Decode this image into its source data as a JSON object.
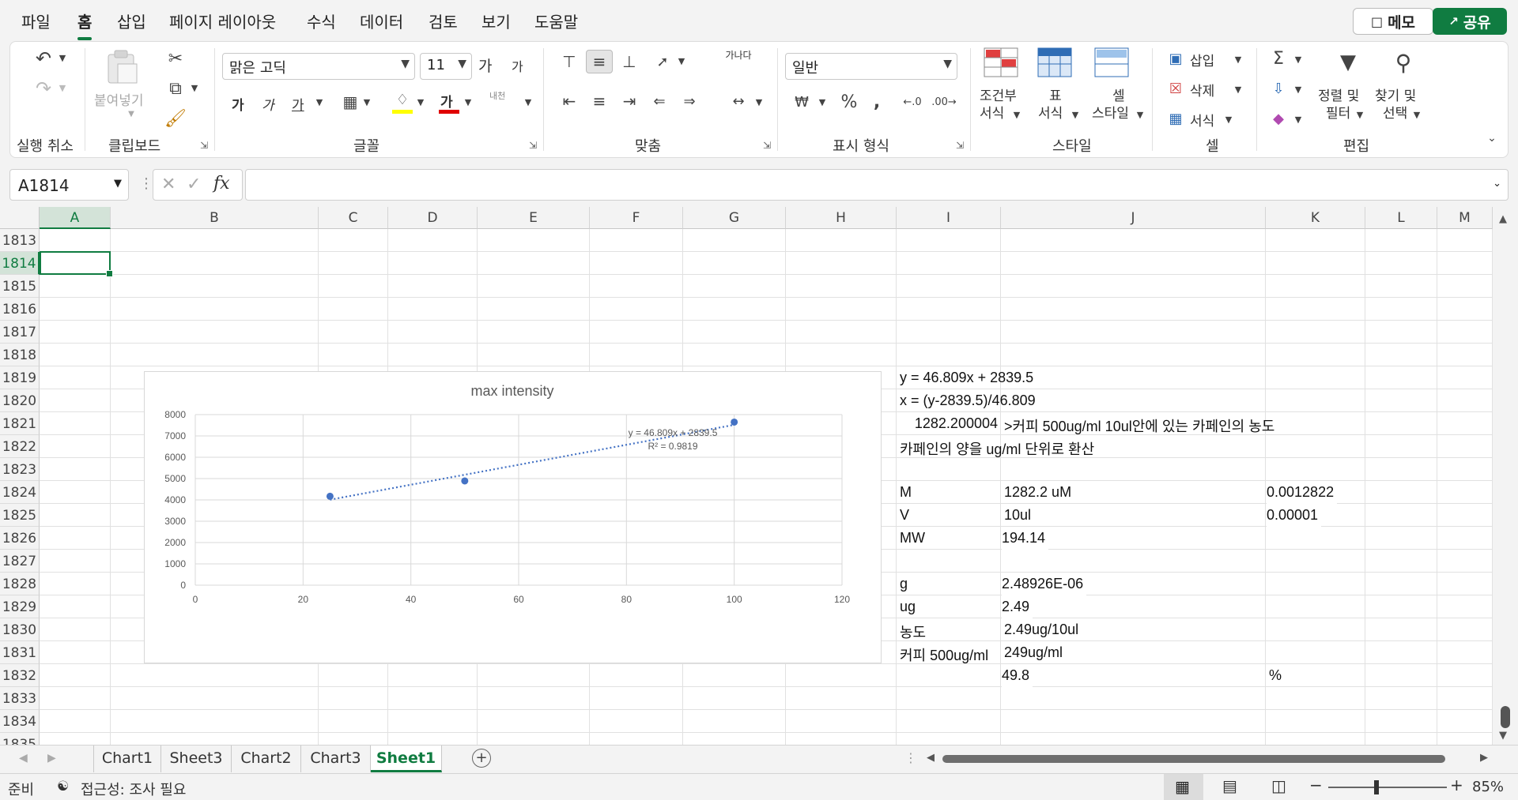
{
  "menu": {
    "tabs": [
      "파일",
      "홈",
      "삽입",
      "페이지 레이아웃",
      "수식",
      "데이터",
      "검토",
      "보기",
      "도움말"
    ],
    "active": "홈",
    "memo_label": "메모",
    "share_label": "공유"
  },
  "ribbon": {
    "undo_group": "실행 취소",
    "clipboard_group": "클립보드",
    "paste_label": "붙여넣기",
    "font_group": "글꼴",
    "font_name": "맑은 고딕",
    "font_size": "11",
    "grow_font": "가",
    "shrink_font": "가",
    "bold": "가",
    "italic": "가",
    "underline": "가",
    "font_color_glyph": "가",
    "phonetic": "내천",
    "align_group": "맞춤",
    "wrap_text": "가나다",
    "number_group": "표시 형식",
    "number_format": "일반",
    "styles_group": "스타일",
    "cond_format": [
      "조건부",
      "서식"
    ],
    "table_format": [
      "표",
      "서식"
    ],
    "cell_styles": [
      "셀",
      "스타일"
    ],
    "cells_group": "셀",
    "insert": "삽입",
    "delete": "삭제",
    "format": "서식",
    "edit_group": "편집",
    "sort_filter": [
      "정렬 및",
      "필터"
    ],
    "find_select": [
      "찾기 및",
      "선택"
    ],
    "colors": {
      "accent": "#107c41",
      "fill_yellow": "#ffff00",
      "font_red": "#e00000"
    }
  },
  "formula_bar": {
    "name_box": "A1814",
    "fx": "fx",
    "content": ""
  },
  "sheet": {
    "columns": [
      "A",
      "B",
      "C",
      "D",
      "E",
      "F",
      "G",
      "H",
      "I",
      "J",
      "K",
      "L",
      "M"
    ],
    "selected_column": "A",
    "rows": [
      "1813",
      "1814",
      "1815",
      "1816",
      "1817",
      "1818",
      "1819",
      "1820",
      "1821",
      "1822",
      "1823",
      "1824",
      "1825",
      "1826",
      "1827",
      "1828",
      "1829",
      "1830",
      "1831",
      "1832",
      "1833",
      "1834",
      "1835"
    ],
    "selected_row": "1814",
    "cells": {
      "I1819": "y = 46.809x + 2839.5",
      "I1820": "x = (y-2839.5)/46.809",
      "I1821": "1282.200004",
      "J1821": ">커피 500ug/ml 10ul안에 있는 카페인의 농도",
      "I1822": "카페인의 양을 ug/ml 단위로 환산",
      "I1824": "M",
      "J1824": "1282.2 uM",
      "K1824": "0.0012822",
      "I1825": "V",
      "J1825": "10ul",
      "K1825": "0.00001",
      "I1826": "MW",
      "J1826": "194.14",
      "I1828": "g",
      "J1828": "2.48926E-06",
      "I1829": "ug",
      "J1829": "2.49",
      "I1830": "농도",
      "J1830": "2.49ug/10ul",
      "I1831": "커피 500ug/ml",
      "J1831": "249ug/ml",
      "J1832": "49.8",
      "K1832": "%"
    }
  },
  "chart_data": {
    "type": "scatter",
    "title": "max intensity",
    "xlabel": "",
    "ylabel": "",
    "xlim": [
      0,
      120
    ],
    "ylim": [
      0,
      8000
    ],
    "xticks": [
      "0",
      "20",
      "40",
      "60",
      "80",
      "100",
      "120"
    ],
    "yticks": [
      "0",
      "1000",
      "2000",
      "3000",
      "4000",
      "5000",
      "6000",
      "7000",
      "8000"
    ],
    "series": [
      {
        "x": [
          25,
          50,
          100
        ],
        "y": [
          4170,
          4890,
          7650
        ]
      }
    ],
    "trendline": {
      "slope": 46.809,
      "intercept": 2839.5,
      "x_range": [
        25,
        100
      ],
      "style": "dotted"
    },
    "equation": "y = 46.809x + 2839.5",
    "r2": "R² = 0.9819",
    "grid": true,
    "series_color": "#4472c4"
  },
  "tabs": {
    "sheets": [
      "Chart1",
      "Sheet3",
      "Chart2",
      "Chart3",
      "Sheet1"
    ],
    "active": "Sheet1"
  },
  "status": {
    "ready": "준비",
    "accessibility": "접근성: 조사 필요",
    "zoom": "85%"
  }
}
